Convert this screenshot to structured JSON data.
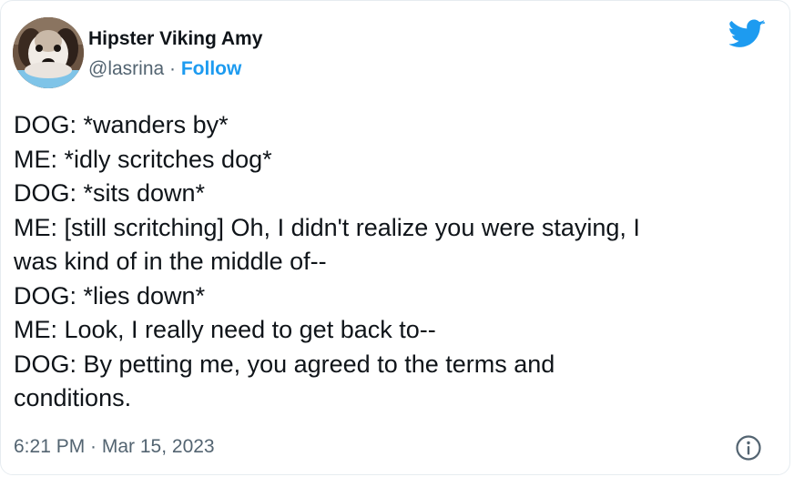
{
  "user": {
    "display_name": "Hipster Viking Amy",
    "handle": "@lasrina",
    "separator": "·",
    "follow_label": "Follow",
    "avatar_icon": "dog-avatar-photo"
  },
  "tweet": {
    "lines": [
      "DOG: *wanders by*",
      "ME: *idly scritches dog*",
      "DOG: *sits down*",
      "ME: [still scritching] Oh, I didn't realize you were staying, I",
      "was kind of in the middle of--",
      "DOG: *lies down*",
      "ME: Look, I really need to get back to--",
      "DOG: By petting me, you agreed to the terms and",
      "conditions."
    ],
    "timestamp": "6:21 PM · Mar 15, 2023"
  },
  "icons": {
    "brand": "twitter-bird-icon",
    "info": "info-icon"
  },
  "colors": {
    "accent": "#1d9bf0",
    "text": "#0f1419",
    "secondary": "#536471",
    "border": "#e6ecf0"
  }
}
